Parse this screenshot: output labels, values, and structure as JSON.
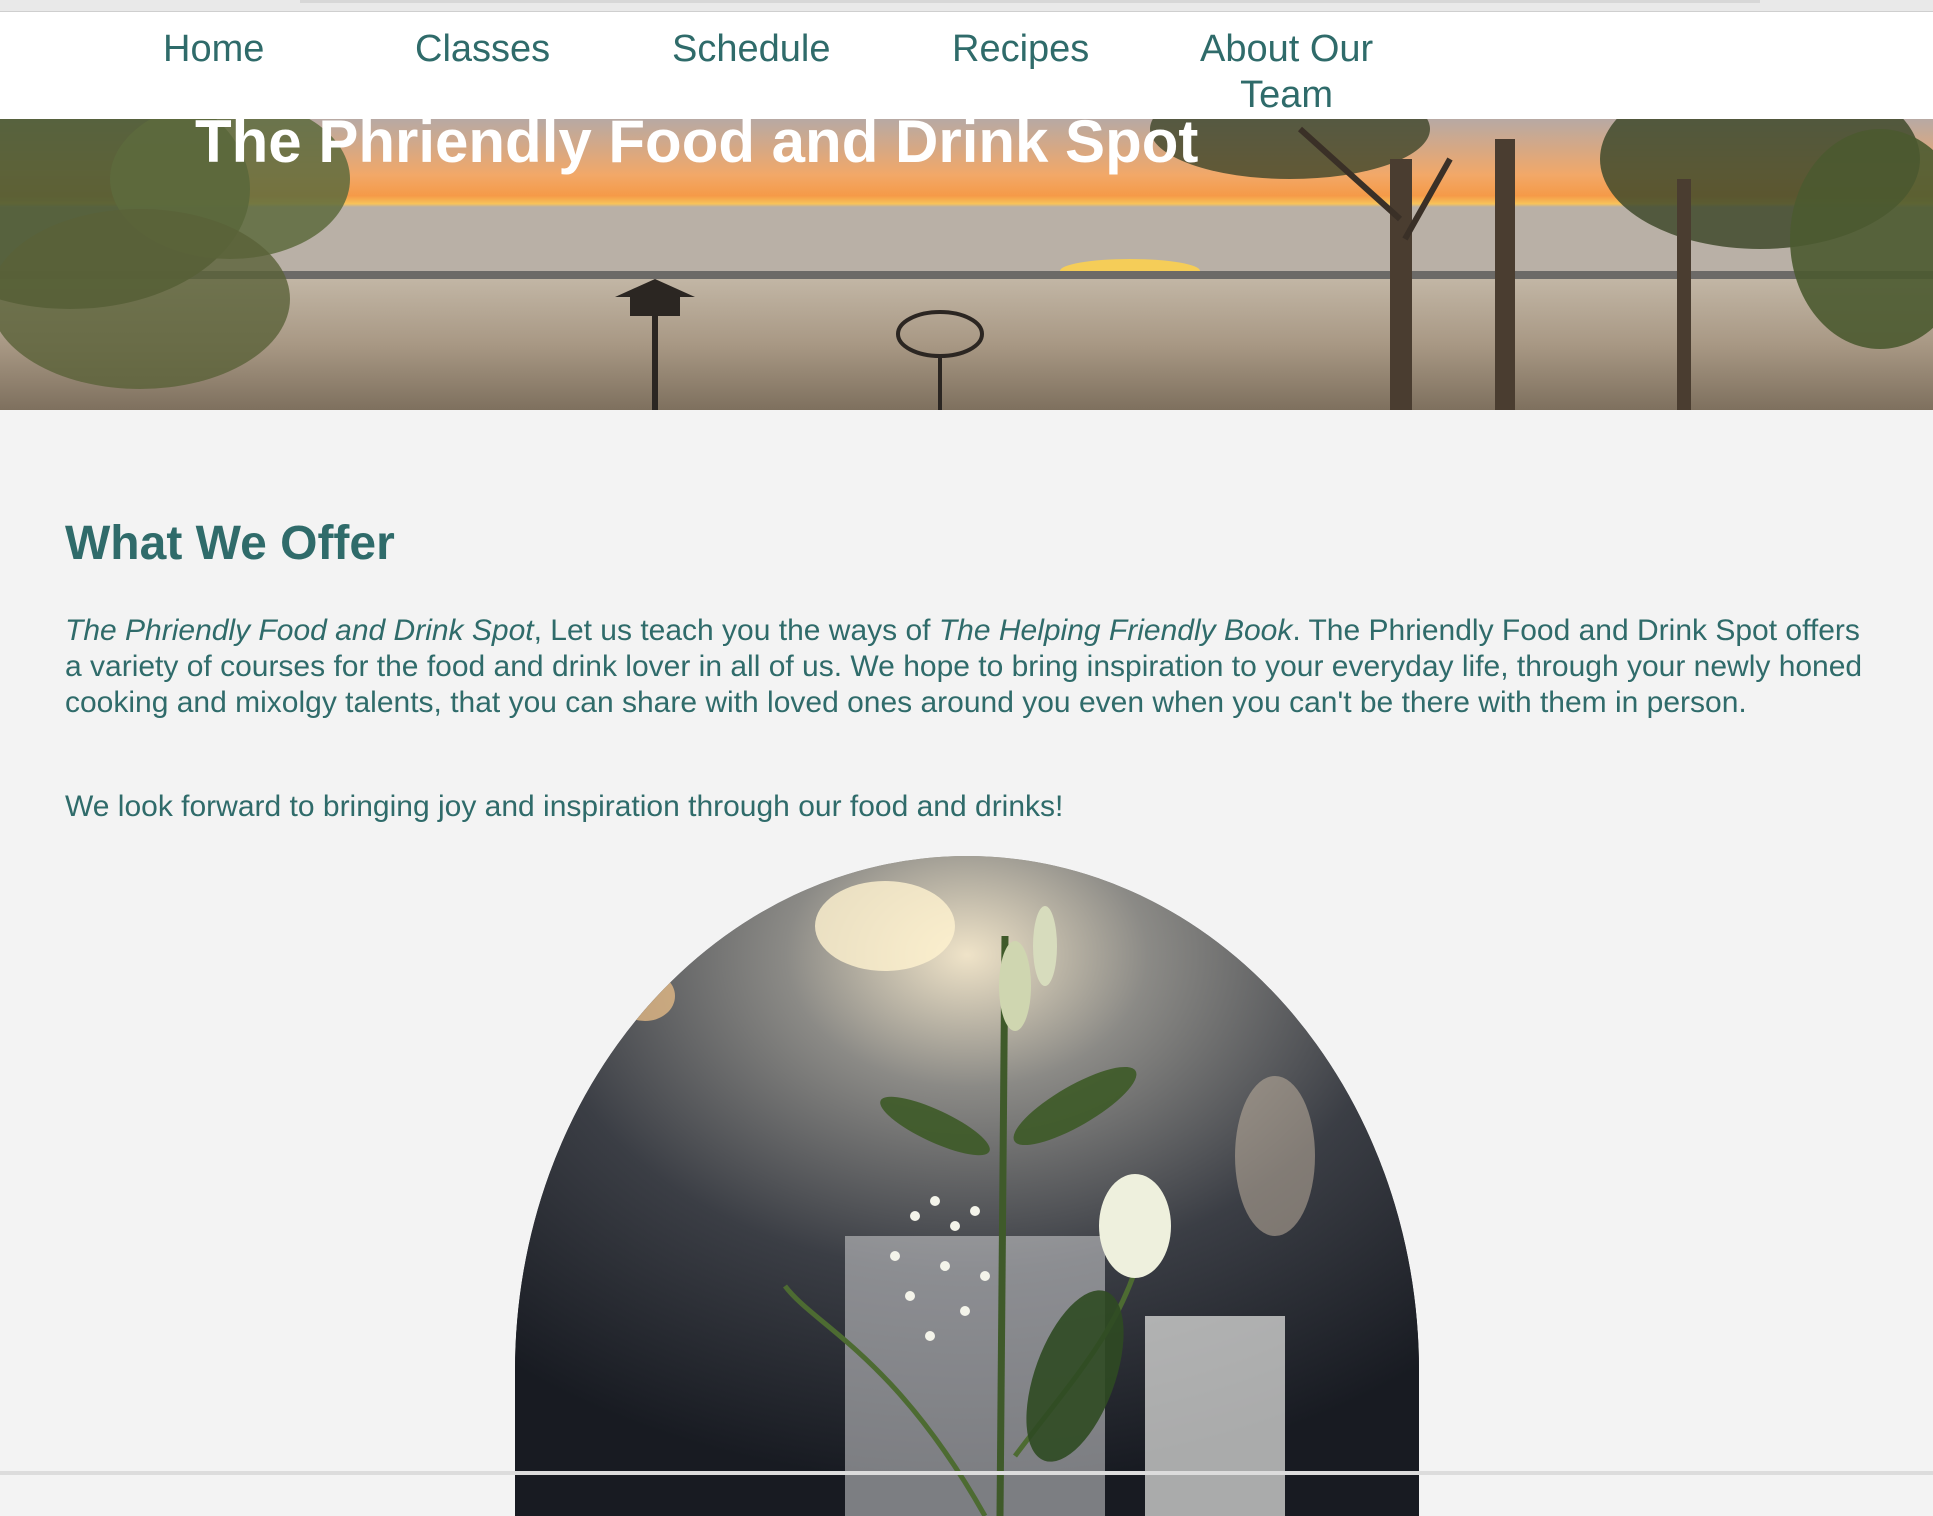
{
  "nav": {
    "items": [
      {
        "label": "Home"
      },
      {
        "label": "Classes"
      },
      {
        "label": "Schedule"
      },
      {
        "label": "Recipes"
      },
      {
        "label_line1": "About Our",
        "label_line2": "Team"
      }
    ]
  },
  "hero": {
    "title": "The Phriendly Food and Drink Spot",
    "image_description": "sunset-over-field-banner"
  },
  "main": {
    "heading": "What We Offer",
    "paragraph1": {
      "italic1": "The Phriendly Food and Drink Spot",
      "text1": ", Let us teach you the ways of ",
      "italic2": "The Helping Friendly Book",
      "text2": ". The Phriendly Food and Drink Spot offers a variety of courses for the food and drink lover in all of us. We hope to bring inspiration to your everyday life, through your newly honed cooking and mixolgy talents, that you can share with loved ones around you even when you can't be there with them in person."
    },
    "paragraph2": "We look forward to bringing joy and inspiration through our food and drinks!",
    "photo": "table-flowers-photo"
  },
  "colors": {
    "accent": "#2f6b6a",
    "background": "#f3f3f3",
    "nav_background": "#ffffff"
  }
}
